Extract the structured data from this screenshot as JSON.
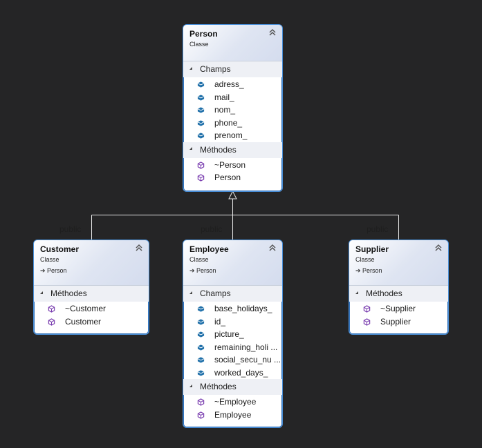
{
  "diagram": {
    "background": "#252526",
    "accent_border": "#4a90d9",
    "field_icon_color": "#1f6fa8",
    "method_icon_color": "#7b3fb0",
    "relationship_label": "public",
    "classes": {
      "person": {
        "name": "Person",
        "kind": "Classe",
        "sections": {
          "fields": {
            "title": "Champs",
            "items": [
              "adress_",
              "mail_",
              "nom_",
              "phone_",
              "prenom_"
            ]
          },
          "methods": {
            "title": "Méthodes",
            "items": [
              "~Person",
              "Person"
            ]
          }
        }
      },
      "customer": {
        "name": "Customer",
        "kind": "Classe",
        "base": "Person",
        "sections": {
          "methods": {
            "title": "Méthodes",
            "items": [
              "~Customer",
              "Customer"
            ]
          }
        }
      },
      "employee": {
        "name": "Employee",
        "kind": "Classe",
        "base": "Person",
        "sections": {
          "fields": {
            "title": "Champs",
            "items": [
              "base_holidays_",
              "id_",
              "picture_",
              "remaining_holi ...",
              "social_secu_nu ...",
              "worked_days_"
            ]
          },
          "methods": {
            "title": "Méthodes",
            "items": [
              "~Employee",
              "Employee"
            ]
          }
        }
      },
      "supplier": {
        "name": "Supplier",
        "kind": "Classe",
        "base": "Person",
        "sections": {
          "methods": {
            "title": "Méthodes",
            "items": [
              "~Supplier",
              "Supplier"
            ]
          }
        }
      }
    },
    "icons": {
      "collapse": "double-chevron-up-icon",
      "field": "field-cube-icon",
      "method": "method-cube-icon",
      "section_toggle": "expanded-triangle-icon",
      "inherits": "inheritance-arrow-icon"
    }
  }
}
